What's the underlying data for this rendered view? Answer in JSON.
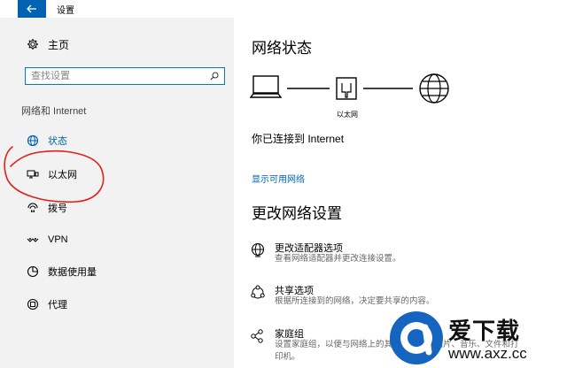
{
  "window": {
    "title": "设置",
    "back_icon": "back-arrow-icon",
    "accent_color": "#0063b1"
  },
  "sidebar": {
    "home_label": "主页",
    "home_icon": "gear-icon",
    "search": {
      "placeholder": "查找设置",
      "icon": "search-icon"
    },
    "section_title": "网络和 Internet",
    "items": [
      {
        "label": "状态",
        "icon": "globe-icon",
        "active": true
      },
      {
        "label": "以太网",
        "icon": "ethernet-icon",
        "active": false
      },
      {
        "label": "拨号",
        "icon": "dialup-icon",
        "active": false
      },
      {
        "label": "VPN",
        "icon": "vpn-icon",
        "active": false
      },
      {
        "label": "数据使用量",
        "icon": "data-usage-icon",
        "active": false
      },
      {
        "label": "代理",
        "icon": "proxy-icon",
        "active": false
      }
    ],
    "annotation_color": "#e0201a"
  },
  "main": {
    "status_title": "网络状态",
    "diagram": {
      "adapter_label": "以太网",
      "icons": [
        "pc-icon",
        "ethernet-port-icon",
        "globe-icon"
      ]
    },
    "connected_text": "你已连接到 Internet",
    "show_networks_link": "显示可用网络",
    "change_title": "更改网络设置",
    "settings": [
      {
        "title": "更改适配器选项",
        "desc": "查看网络适配器并更改连接设置。",
        "icon": "adapter-globe-icon"
      },
      {
        "title": "共享选项",
        "desc": "根据所连接到的网络，决定要共享的内容。",
        "icon": "share-icon"
      },
      {
        "title": "家庭组",
        "desc": "设置家庭组，以便与网络上的其他电脑共享图片、音乐、文件和打印机。",
        "icon": "homegroup-icon"
      }
    ]
  },
  "watermark": {
    "brand": "爱下载",
    "url": "www.axz.cc",
    "color": "#1565c0"
  }
}
